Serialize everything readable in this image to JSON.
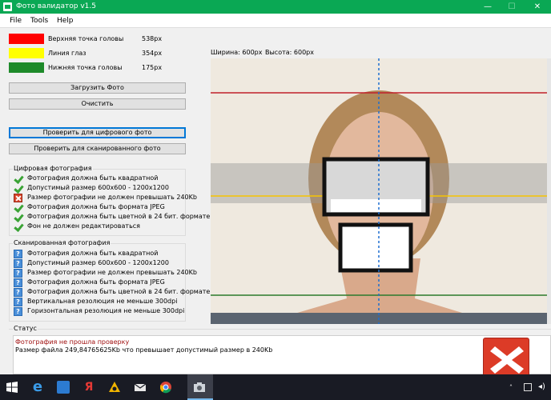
{
  "window": {
    "title": "Фото валидатор v1.5",
    "controls": {
      "minimize": "—",
      "maximize": "☐",
      "close": "✕"
    }
  },
  "menu": {
    "items": [
      "File",
      "Tools",
      "Help"
    ]
  },
  "legend": [
    {
      "label": "Верхняя точка головы",
      "value": "538px",
      "color": "#ff0000"
    },
    {
      "label": "Линия глаз",
      "value": "354px",
      "color": "#ffff00"
    },
    {
      "label": "Нижняя точка головы",
      "value": "175px",
      "color": "#1e8a2a"
    }
  ],
  "buttons": {
    "load": "Загрузить Фото",
    "clear": "Очистить",
    "check_digital": "Проверить для цифрового фото",
    "check_scanned": "Проверить для сканированного фото"
  },
  "digital": {
    "title": "Цифровая фотография",
    "items": [
      {
        "text": "Фотография должна быть квадратной",
        "status": "ok"
      },
      {
        "text": "Допустимый размер 600x600 - 1200x1200",
        "status": "ok"
      },
      {
        "text": "Размер фотографии не должен превышать 240Kb",
        "status": "error"
      },
      {
        "text": "Фотография должна быть формата JPEG",
        "status": "ok"
      },
      {
        "text": "Фотография должна быть цветной в 24 бит. формате",
        "status": "ok"
      },
      {
        "text": "Фон не должен редактироваться",
        "status": "ok"
      }
    ]
  },
  "scanned": {
    "title": "Сканированная фотография",
    "items": [
      {
        "text": "Фотография должна быть квадратной",
        "status": "unknown"
      },
      {
        "text": "Допустимый размер 600x600 - 1200x1200",
        "status": "unknown"
      },
      {
        "text": "Размер фотографии не должен превышать 240Kb",
        "status": "unknown"
      },
      {
        "text": "Фотография должна быть формата JPEG",
        "status": "unknown"
      },
      {
        "text": "Фотография должна быть цветной в 24 бит. формате",
        "status": "unknown"
      },
      {
        "text": "Вертикальная резолюция не меньше 300dpi",
        "status": "unknown"
      },
      {
        "text": "Горизонтальная резолюция не меньше 300dpi",
        "status": "unknown"
      }
    ]
  },
  "image": {
    "width_label": "Ширина: 600px",
    "height_label": "Высота: 600px"
  },
  "status": {
    "title": "Статус",
    "line1": "Фотография не прошла проверку",
    "line2": "Размер файла 249,84765625Kb что превышает допустимый размер в 240Kb",
    "line1_color": "#a01010"
  },
  "taskbar": {
    "icons": [
      "windows-icon",
      "edge-icon",
      "media-icon",
      "yandex-icon",
      "archive-icon",
      "mail-icon",
      "chrome-icon",
      "camera-app-icon"
    ],
    "tray": [
      "chevron-up-icon",
      "network-icon",
      "volume-icon"
    ]
  }
}
